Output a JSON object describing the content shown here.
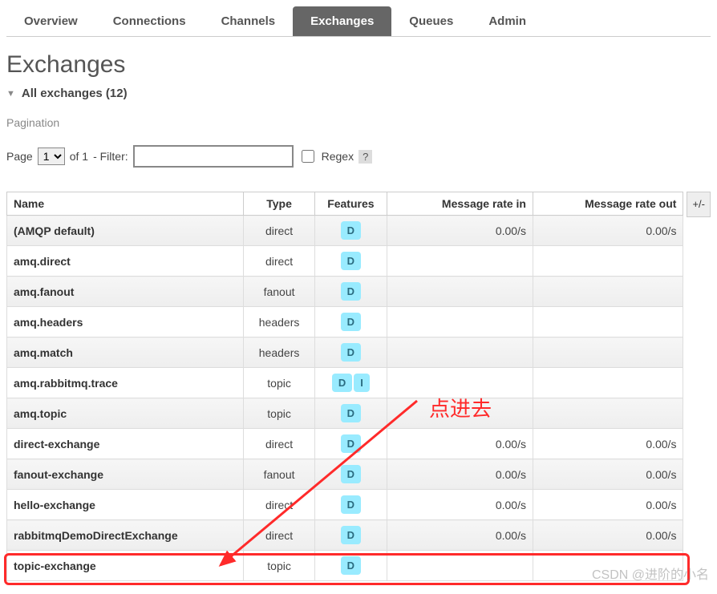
{
  "tabs": {
    "overview": "Overview",
    "connections": "Connections",
    "channels": "Channels",
    "exchanges": "Exchanges",
    "queues": "Queues",
    "admin": "Admin",
    "active": "exchanges"
  },
  "page_title": "Exchanges",
  "section": {
    "title": "All exchanges (12)"
  },
  "pagination": {
    "label": "Pagination",
    "page_label": "Page",
    "page_value": "1",
    "of_label": "of 1",
    "filter_label": "- Filter:",
    "filter_value": "",
    "regex_label": "Regex",
    "help": "?"
  },
  "columns": {
    "name": "Name",
    "type": "Type",
    "features": "Features",
    "rate_in": "Message rate in",
    "rate_out": "Message rate out",
    "addcol": "+/-"
  },
  "rows": [
    {
      "name": "(AMQP default)",
      "link": false,
      "type": "direct",
      "features": [
        "D"
      ],
      "in": "0.00/s",
      "out": "0.00/s"
    },
    {
      "name": "amq.direct",
      "link": true,
      "type": "direct",
      "features": [
        "D"
      ],
      "in": "",
      "out": ""
    },
    {
      "name": "amq.fanout",
      "link": true,
      "type": "fanout",
      "features": [
        "D"
      ],
      "in": "",
      "out": ""
    },
    {
      "name": "amq.headers",
      "link": true,
      "type": "headers",
      "features": [
        "D"
      ],
      "in": "",
      "out": ""
    },
    {
      "name": "amq.match",
      "link": true,
      "type": "headers",
      "features": [
        "D"
      ],
      "in": "",
      "out": ""
    },
    {
      "name": "amq.rabbitmq.trace",
      "link": true,
      "type": "topic",
      "features": [
        "D",
        "I"
      ],
      "in": "",
      "out": ""
    },
    {
      "name": "amq.topic",
      "link": true,
      "type": "topic",
      "features": [
        "D"
      ],
      "in": "",
      "out": ""
    },
    {
      "name": "direct-exchange",
      "link": true,
      "type": "direct",
      "features": [
        "D"
      ],
      "in": "0.00/s",
      "out": "0.00/s"
    },
    {
      "name": "fanout-exchange",
      "link": true,
      "type": "fanout",
      "features": [
        "D"
      ],
      "in": "0.00/s",
      "out": "0.00/s"
    },
    {
      "name": "hello-exchange",
      "link": true,
      "type": "direct",
      "features": [
        "D"
      ],
      "in": "0.00/s",
      "out": "0.00/s"
    },
    {
      "name": "rabbitmqDemoDirectExchange",
      "link": true,
      "type": "direct",
      "features": [
        "D"
      ],
      "in": "0.00/s",
      "out": "0.00/s"
    },
    {
      "name": "topic-exchange",
      "link": true,
      "type": "topic",
      "features": [
        "D"
      ],
      "in": "",
      "out": ""
    }
  ],
  "annotation": {
    "text": "点进去"
  },
  "watermark": "CSDN @进阶的小名"
}
